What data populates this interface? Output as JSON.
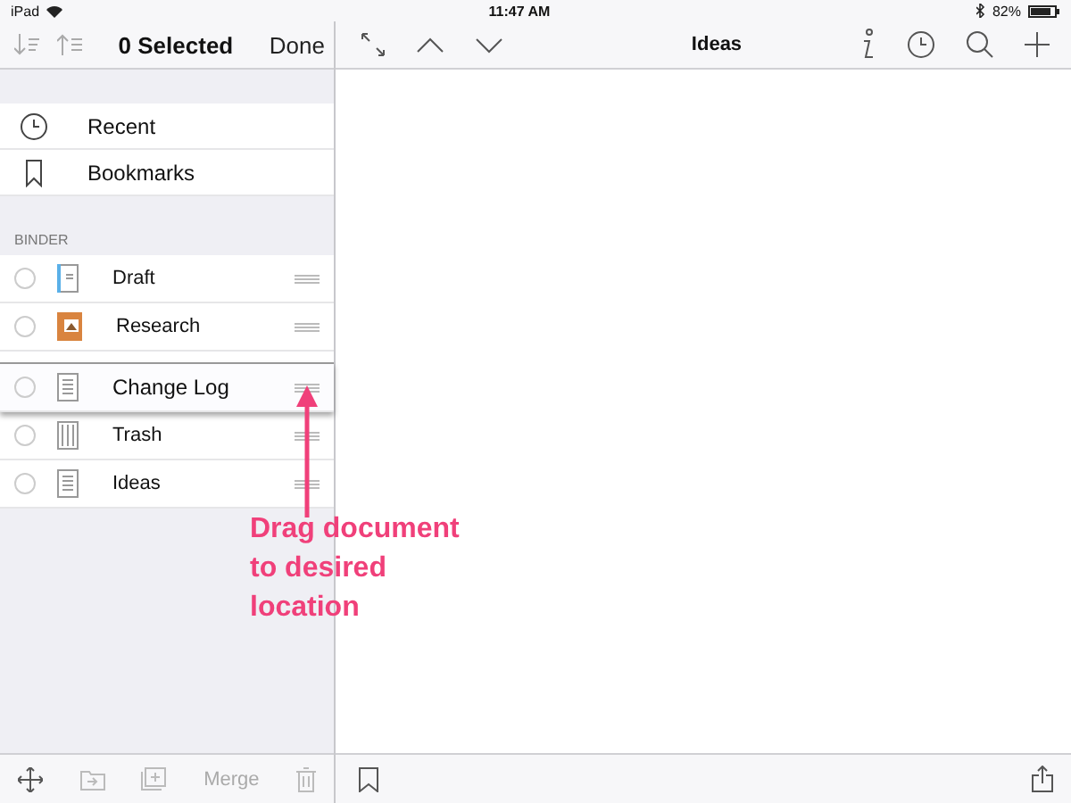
{
  "status_bar": {
    "device": "iPad",
    "time": "11:47 AM",
    "battery": "82%"
  },
  "sidebar": {
    "title": "0 Selected",
    "done": "Done",
    "shortcuts": [
      {
        "label": "Recent",
        "kind": "clock"
      },
      {
        "label": "Bookmarks",
        "kind": "bookmark"
      }
    ],
    "section": "BINDER",
    "items": [
      {
        "label": "Draft",
        "kind": "draft",
        "selected": false
      },
      {
        "label": "Research",
        "kind": "research",
        "selected": false
      },
      {
        "label": "Trash",
        "kind": "trash",
        "selected": false
      },
      {
        "label": "Ideas",
        "kind": "doc",
        "selected": false
      }
    ],
    "dragged": {
      "label": "Change Log",
      "kind": "doc",
      "selected": false
    },
    "footer": {
      "merge": "Merge"
    }
  },
  "editor": {
    "title": "Ideas"
  },
  "annotation": "Drag document to desired location"
}
